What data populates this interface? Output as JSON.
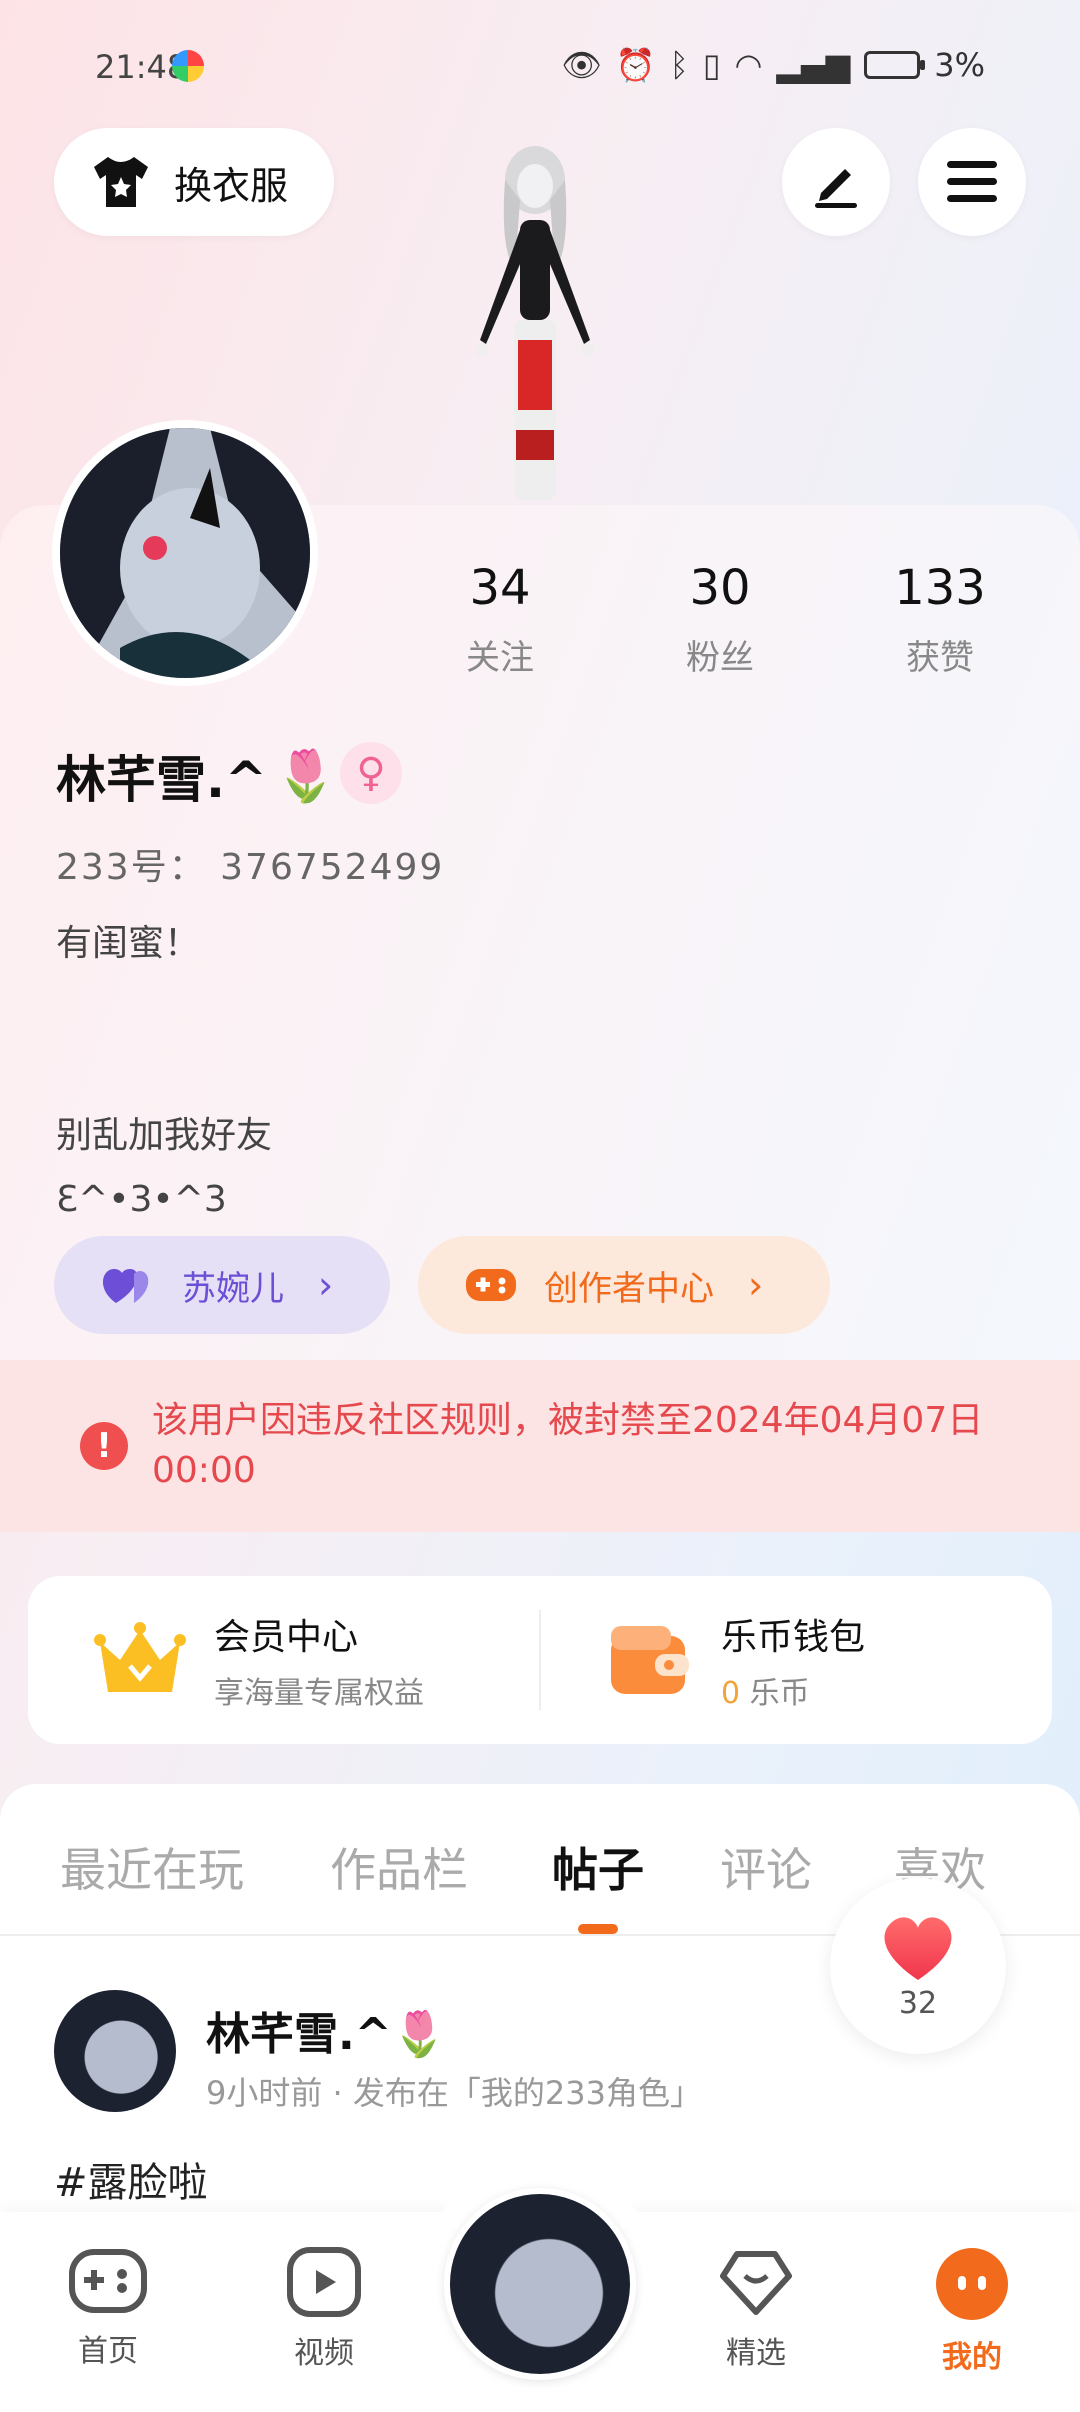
{
  "status_bar": {
    "time": "21:48",
    "battery": "3%"
  },
  "header": {
    "outfit_label": "换衣服"
  },
  "stats": [
    {
      "value": "34",
      "label": "关注"
    },
    {
      "value": "30",
      "label": "粉丝"
    },
    {
      "value": "133",
      "label": "获赞"
    }
  ],
  "profile": {
    "name": "林芊雪.^",
    "name_emoji": "🌷",
    "gender_symbol": "♀",
    "id_line": "233号： 376752499",
    "bio": "有闺蜜！\n\n\n 别乱加我好友\nƐ^•3•^3"
  },
  "pills": {
    "family": "苏婉儿",
    "creator": "创作者中心"
  },
  "ban_notice": "该用户因违反社区规则，被封禁至2024年04月07日 00:00",
  "wallet": {
    "member_title": "会员中心",
    "member_sub": "享海量专属权益",
    "coin_title": "乐币钱包",
    "coin_amount": "0",
    "coin_unit": "乐币"
  },
  "tabs": [
    "最近在玩",
    "作品栏",
    "帖子",
    "评论",
    "喜欢"
  ],
  "active_tab": "帖子",
  "like_count": "32",
  "post": {
    "author": "林芊雪.^",
    "author_emoji": "🌷",
    "meta": "9小时前 · 发布在「我的233角色」",
    "content": "#露脸啦"
  },
  "nav": [
    {
      "label": "首页"
    },
    {
      "label": "视频"
    },
    {
      "label": "精选"
    },
    {
      "label": "我的"
    }
  ],
  "colors": {
    "accent": "#f26a1b",
    "ban": "#e5484d",
    "family": "#6c4fd6",
    "gender": "#f06292"
  }
}
